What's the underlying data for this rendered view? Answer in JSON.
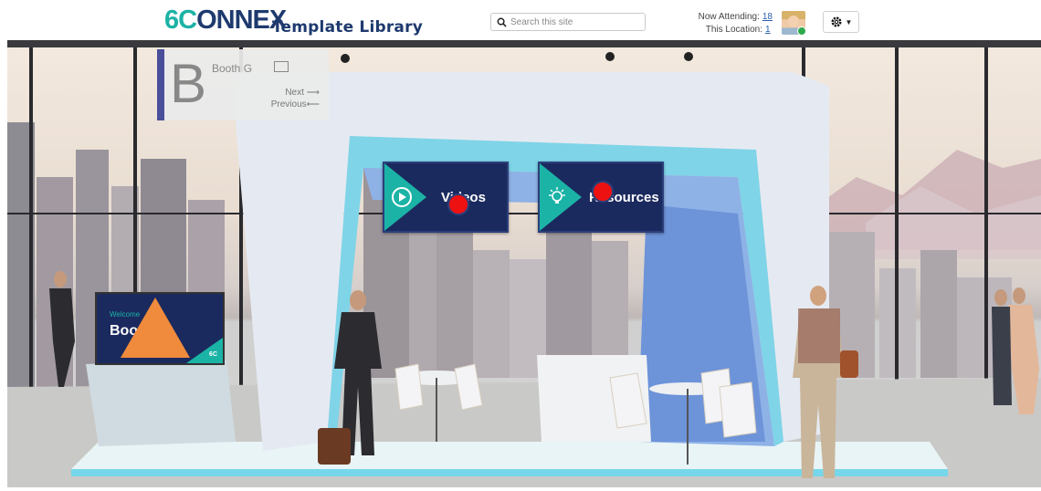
{
  "header": {
    "logo_prefix": "6C",
    "logo_rest": "ONNEX",
    "title": "Template Library",
    "search_placeholder": "Search this site",
    "now_attending_label": "Now Attending:",
    "now_attending_count": "18",
    "location_label": "This Location:",
    "location_count": "1",
    "avatar_icon": "user-avatar",
    "settings_icon": "gear-icon"
  },
  "booth": {
    "letter": "B",
    "name": "Booth G",
    "next_label": "Next",
    "previous_label": "Previous"
  },
  "screens": {
    "videos_label": "Videos",
    "resources_label": "Resources",
    "welcome_small": "Welcome",
    "welcome_big": "Boo",
    "welcome_brand": "6C"
  },
  "colors": {
    "brand_navy": "#1e3a6e",
    "brand_teal": "#1bb3a6",
    "hotspot_red": "#ee1111",
    "marker_orange": "#f08a3c"
  }
}
